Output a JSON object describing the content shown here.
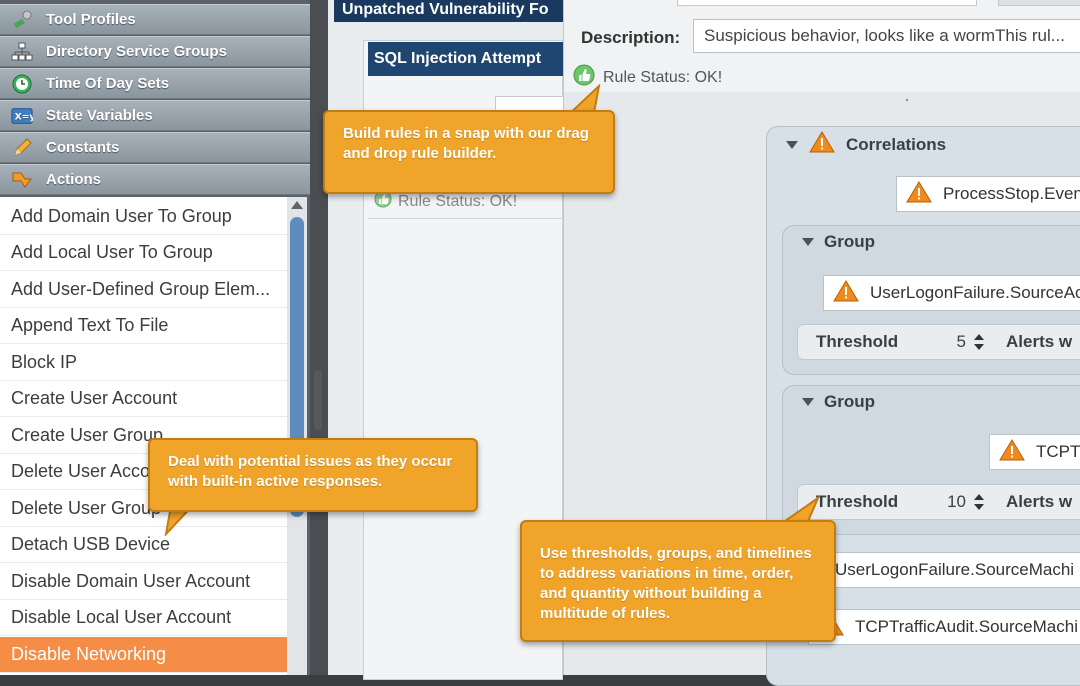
{
  "sidebar": {
    "categories": [
      {
        "label": "Tool Profiles",
        "icon": "tool-profiles-icon"
      },
      {
        "label": "Directory Service Groups",
        "icon": "directory-groups-icon"
      },
      {
        "label": "Time Of Day Sets",
        "icon": "clock-icon"
      },
      {
        "label": "State Variables",
        "icon": "state-variables-icon"
      },
      {
        "label": "Constants",
        "icon": "pencil-icon"
      },
      {
        "label": "Actions",
        "icon": "actions-icon"
      }
    ],
    "actions": [
      "Add Domain User To Group",
      "Add Local User To Group",
      "Add User-Defined Group Elem...",
      "Append Text To File",
      "Block IP",
      "Create User Account",
      "Create User Group",
      "Delete User Account",
      "Delete User Group",
      "Detach USB Device",
      "Disable Domain User Account",
      "Disable Local User Account",
      "Disable Networking"
    ],
    "selected_action": "Disable Networking"
  },
  "middle": {
    "tab_title": "Unpatched Vulnerability Fo",
    "inner_tab_title": "SQL Injection Attempt",
    "rule_status": "Rule Status: OK!"
  },
  "main": {
    "description_label": "Description:",
    "description_value": "Suspicious behavior, looks like a wormThis rul...",
    "rule_status": "Rule Status: OK!",
    "correlations_label": "Correlations",
    "alerts": {
      "process_stop": "ProcessStop.Even",
      "user_logon_failure": "UserLogonFailure.SourceAc",
      "tcp_short": "TCPTr",
      "user_logon_failure_machine": "UserLogonFailure.SourceMachi",
      "tcp_traffic_audit": "TCPTrafficAudit.SourceMachi"
    },
    "groups": [
      {
        "label": "Group",
        "threshold_label": "Threshold",
        "threshold_value": "5",
        "alerts_label": "Alerts w"
      },
      {
        "label": "Group",
        "threshold_label": "Threshold",
        "threshold_value": "10",
        "alerts_label": "Alerts w"
      }
    ]
  },
  "callouts": {
    "rule_builder": "Build rules in a snap with our drag and drop rule builder.",
    "active_responses": "Deal with potential issues as they occur with built-in active responses.",
    "thresholds": "Use thresholds, groups, and timelines to address variations in time, order, and quantity without building a multitude of rules."
  },
  "colors": {
    "callout": "#f0a429",
    "selected_row": "#f58d46",
    "tab_navy": "#193a5e",
    "warning": "#f08a1c"
  }
}
